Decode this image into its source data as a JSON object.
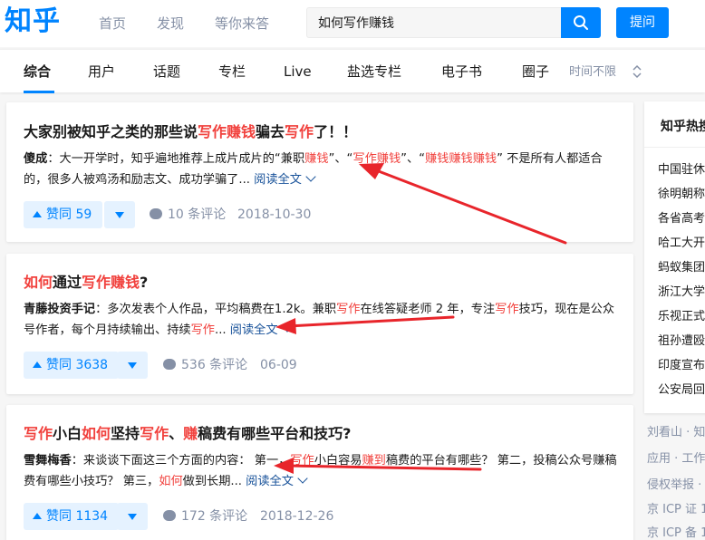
{
  "header": {
    "logo": "知乎",
    "nav": [
      "首页",
      "发现",
      "等你来答"
    ],
    "search_value": "如何写作赚钱",
    "ask_label": "提问"
  },
  "tabs": [
    "综合",
    "用户",
    "话题",
    "专栏",
    "Live",
    "盐选专栏",
    "电子书",
    "圈子"
  ],
  "time_filter": "时间不限",
  "results": [
    {
      "title_parts": [
        {
          "t": "大家别被知乎之类的那些说",
          "hl": false
        },
        {
          "t": "写作赚钱",
          "hl": true
        },
        {
          "t": "骗去",
          "hl": false
        },
        {
          "t": "写作",
          "hl": true
        },
        {
          "t": "了！！",
          "hl": false
        }
      ],
      "author": "傻成",
      "excerpt_parts": [
        {
          "t": "：大一开学时，知乎遍地推荐上成片成片的“兼职",
          "hl": false
        },
        {
          "t": "赚钱",
          "hl": true
        },
        {
          "t": "”、“",
          "hl": false
        },
        {
          "t": "写作赚钱",
          "hl": true
        },
        {
          "t": "”、“",
          "hl": false
        },
        {
          "t": "赚钱赚钱赚钱",
          "hl": true
        },
        {
          "t": "” 不是所有人都适合的，很多人被鸡汤和励志文、成功学骗了...",
          "hl": false
        }
      ],
      "read_more": "阅读全文",
      "vote": "赞同 59",
      "comments": "10 条评论",
      "date": "2018-10-30"
    },
    {
      "title_parts": [
        {
          "t": "如何",
          "hl": true
        },
        {
          "t": "通过",
          "hl": false
        },
        {
          "t": "写作赚钱",
          "hl": true
        },
        {
          "t": "?",
          "hl": false
        }
      ],
      "author": "青藤投资手记",
      "excerpt_parts": [
        {
          "t": "：多次发表个人作品，平均稿费在1.2k。兼职",
          "hl": false
        },
        {
          "t": "写作",
          "hl": true
        },
        {
          "t": "在线答疑老师 2 年，专注",
          "hl": false
        },
        {
          "t": "写作",
          "hl": true
        },
        {
          "t": "技巧，现在是公众号作者，每个月持续输出、持续",
          "hl": false
        },
        {
          "t": "写作",
          "hl": true
        },
        {
          "t": "...",
          "hl": false
        }
      ],
      "read_more": "阅读全文",
      "vote": "赞同 3638",
      "comments": "536 条评论",
      "date": "06-09"
    },
    {
      "title_parts": [
        {
          "t": "写作",
          "hl": true
        },
        {
          "t": "小白",
          "hl": false
        },
        {
          "t": "如何",
          "hl": true
        },
        {
          "t": "坚持",
          "hl": false
        },
        {
          "t": "写作",
          "hl": true
        },
        {
          "t": "、",
          "hl": false
        },
        {
          "t": "赚",
          "hl": true
        },
        {
          "t": "稿费有哪些平台和技巧?",
          "hl": false
        }
      ],
      "author": "雪舞梅香",
      "excerpt_parts": [
        {
          "t": "：来谈谈下面这三个方面的内容： 第一，",
          "hl": false
        },
        {
          "t": "写作",
          "hl": true
        },
        {
          "t": "小白容易",
          "hl": false
        },
        {
          "t": "赚到",
          "hl": true
        },
        {
          "t": "稿费的平台有哪些？ 第二，投稿公众号赚稿费有哪些小技巧？ 第三，",
          "hl": false
        },
        {
          "t": "如何",
          "hl": true
        },
        {
          "t": "做到长期...",
          "hl": false
        }
      ],
      "read_more": "阅读全文",
      "vote": "赞同 1134",
      "comments": "172 条评论",
      "date": "2018-12-26"
    }
  ],
  "sidebar": {
    "title": "知乎热搜",
    "items": [
      "中国驻休",
      "徐明朝称",
      "各省高考",
      "哈工大开",
      "蚂蚁集团",
      "浙江大学",
      "乐视正式",
      "祖孙遭殴",
      "印度宣布",
      "公安局回"
    ]
  },
  "footer_links": [
    "刘看山 · 知",
    "应用 · 工作",
    "侵权举报 ·",
    "京 ICP 证 1",
    "京 ICP 备 1"
  ],
  "colors": {
    "brand": "#0084ff",
    "highlight": "#f1403c",
    "annotation_arrow": "#e8252b"
  }
}
